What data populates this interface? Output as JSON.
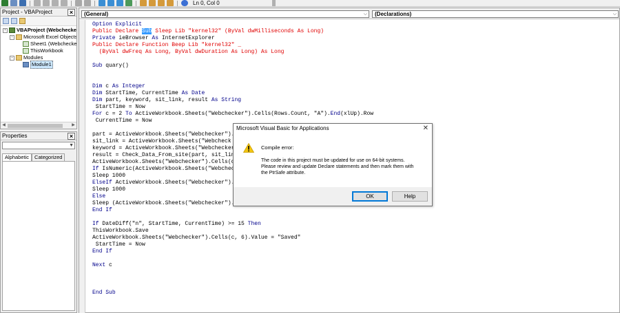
{
  "toolbar": {
    "status": "Ln 0, Col 0"
  },
  "project_panel": {
    "title": "Project - VBAProject",
    "tree": [
      {
        "label": "VBAProject (Webchecker)",
        "level": 0,
        "expand": "-",
        "icon": "vba-project-icon",
        "bold": true
      },
      {
        "label": "Microsoft Excel Objects",
        "level": 1,
        "expand": "-",
        "icon": "folder-icon"
      },
      {
        "label": "Sheet1 (Webchecker)",
        "level": 2,
        "expand": "",
        "icon": "worksheet-icon"
      },
      {
        "label": "ThisWorkbook",
        "level": 2,
        "expand": "",
        "icon": "workbook-icon"
      },
      {
        "label": "Modules",
        "level": 1,
        "expand": "-",
        "icon": "folder-icon"
      },
      {
        "label": "Module1",
        "level": 2,
        "expand": "",
        "icon": "module-icon",
        "selected": true
      }
    ]
  },
  "properties_panel": {
    "title": "Properties",
    "tabs": [
      "Alphabetic",
      "Categorized"
    ],
    "active_tab": 0
  },
  "code_window": {
    "object_combo": "(General)",
    "procedure_combo": "(Declarations)",
    "lines": [
      {
        "text": "Option Explicit",
        "style": "keyword"
      },
      {
        "text": "Public Declare Sub Sleep Lib \"kernel32\" (ByVal dwMilliseconds As Long)",
        "style": "error",
        "sel": "Sub"
      },
      {
        "text": "Private ieBrowser As InternetExplorer",
        "style": "mixed"
      },
      {
        "text": "Public Declare Function Beep Lib \"kernel32\" _",
        "style": "error"
      },
      {
        "text": "  (ByVal dwFreq As Long, ByVal dwDuration As Long) As Long",
        "style": "error"
      },
      {
        "text": "",
        "style": "plain"
      },
      {
        "text": "Sub quary()",
        "style": "mixed"
      },
      {
        "text": "",
        "style": "plain"
      },
      {
        "text": "",
        "style": "plain"
      },
      {
        "text": "Dim c As Integer",
        "style": "mixed"
      },
      {
        "text": "Dim StartTime, CurrentTime As Date",
        "style": "mixed"
      },
      {
        "text": "Dim part, keyword, sit_link, result As String",
        "style": "mixed"
      },
      {
        "text": " StartTime = Now",
        "style": "plain"
      },
      {
        "text": "For c = 2 To ActiveWorkbook.Sheets(\"Webchecker\").Cells(Rows.Count, \"A\").End(xlUp).Row",
        "style": "mixed"
      },
      {
        "text": " CurrentTime = Now",
        "style": "plain"
      },
      {
        "text": "",
        "style": "plain"
      },
      {
        "text": "part = ActiveWorkbook.Sheets(\"Webchecker\").",
        "style": "plain"
      },
      {
        "text": "sit_link = ActiveWorkbook.Sheets(\"Webcheck",
        "style": "plain"
      },
      {
        "text": "keyword = ActiveWorkbook.Sheets(\"Webchecker",
        "style": "plain"
      },
      {
        "text": "result = Check_Data_From_site(part, sit_lin",
        "style": "plain"
      },
      {
        "text": "ActiveWorkbook.Sheets(\"Webchecker\").Cells(c",
        "style": "plain"
      },
      {
        "text": "If IsNumeric(ActiveWorkbook.Sheets(\"Webchec",
        "style": "mixed"
      },
      {
        "text": "Sleep 1000",
        "style": "plain"
      },
      {
        "text": "ElseIf ActiveWorkbook.Sheets(\"Webchecker\").",
        "style": "mixed"
      },
      {
        "text": "Sleep 1000",
        "style": "plain"
      },
      {
        "text": "Else",
        "style": "keyword"
      },
      {
        "text": "Sleep (ActiveWorkbook.Sheets(\"Webchecker\").",
        "style": "plain"
      },
      {
        "text": "End If",
        "style": "keyword"
      },
      {
        "text": "",
        "style": "plain"
      },
      {
        "text": "If DateDiff(\"n\", StartTime, CurrentTime) >= 15 Then",
        "style": "mixed"
      },
      {
        "text": "ThisWorkbook.Save",
        "style": "plain"
      },
      {
        "text": "ActiveWorkbook.Sheets(\"Webchecker\").Cells(c, 6).Value = \"Saved\"",
        "style": "plain"
      },
      {
        "text": " StartTime = Now",
        "style": "plain"
      },
      {
        "text": "End If",
        "style": "keyword"
      },
      {
        "text": "",
        "style": "plain"
      },
      {
        "text": "Next c",
        "style": "keyword"
      },
      {
        "text": "",
        "style": "plain"
      },
      {
        "text": "",
        "style": "plain"
      },
      {
        "text": "",
        "style": "plain"
      },
      {
        "text": "End Sub",
        "style": "keyword"
      }
    ]
  },
  "dialog": {
    "title": "Microsoft Visual Basic for Applications",
    "heading": "Compile error:",
    "message": "The code in this project must be updated for use on 64-bit systems.\nPlease review and update Declare statements and then mark them with\nthe PtrSafe attribute.",
    "ok_label": "OK",
    "help_label": "Help",
    "icon": "warning-icon"
  }
}
